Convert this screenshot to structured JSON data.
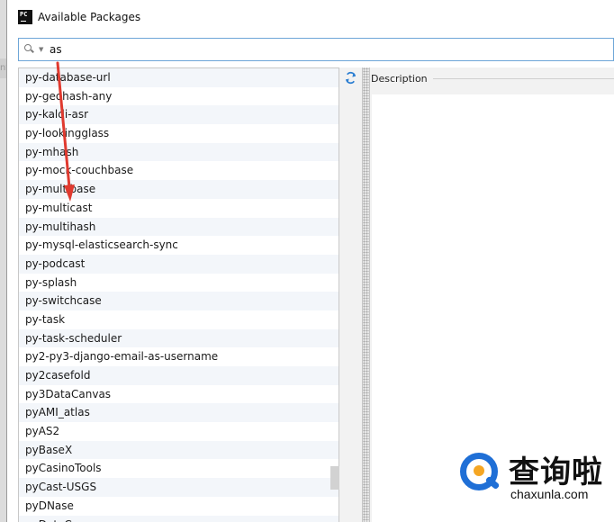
{
  "window": {
    "title": "Available Packages",
    "app_icon_text": "PC"
  },
  "background_sliver_text": "nt",
  "search": {
    "value": "as",
    "placeholder": ""
  },
  "packages": [
    "py-database-url",
    "py-geohash-any",
    "py-kaldi-asr",
    "py-lookingglass",
    "py-mhash",
    "py-mock-couchbase",
    "py-multibase",
    "py-multicast",
    "py-multihash",
    "py-mysql-elasticsearch-sync",
    "py-podcast",
    "py-splash",
    "py-switchcase",
    "py-task",
    "py-task-scheduler",
    "py2-py3-django-email-as-username",
    "py2casefold",
    "py3DataCanvas",
    "pyAMI_atlas",
    "pyAS2",
    "pyBaseX",
    "pyCasinoTools",
    "pyCast-USGS",
    "pyDNase",
    "pyDataCanvas"
  ],
  "description": {
    "header": "Description"
  },
  "watermark": {
    "chinese": "查询啦",
    "domain": "chaxunla.com"
  },
  "colors": {
    "annotation_arrow": "#e03a2f",
    "search_border": "#6ea6d8",
    "refresh_icon": "#2d7fd2",
    "watermark_blue": "#1f6fd6",
    "watermark_orange": "#f5a623"
  }
}
